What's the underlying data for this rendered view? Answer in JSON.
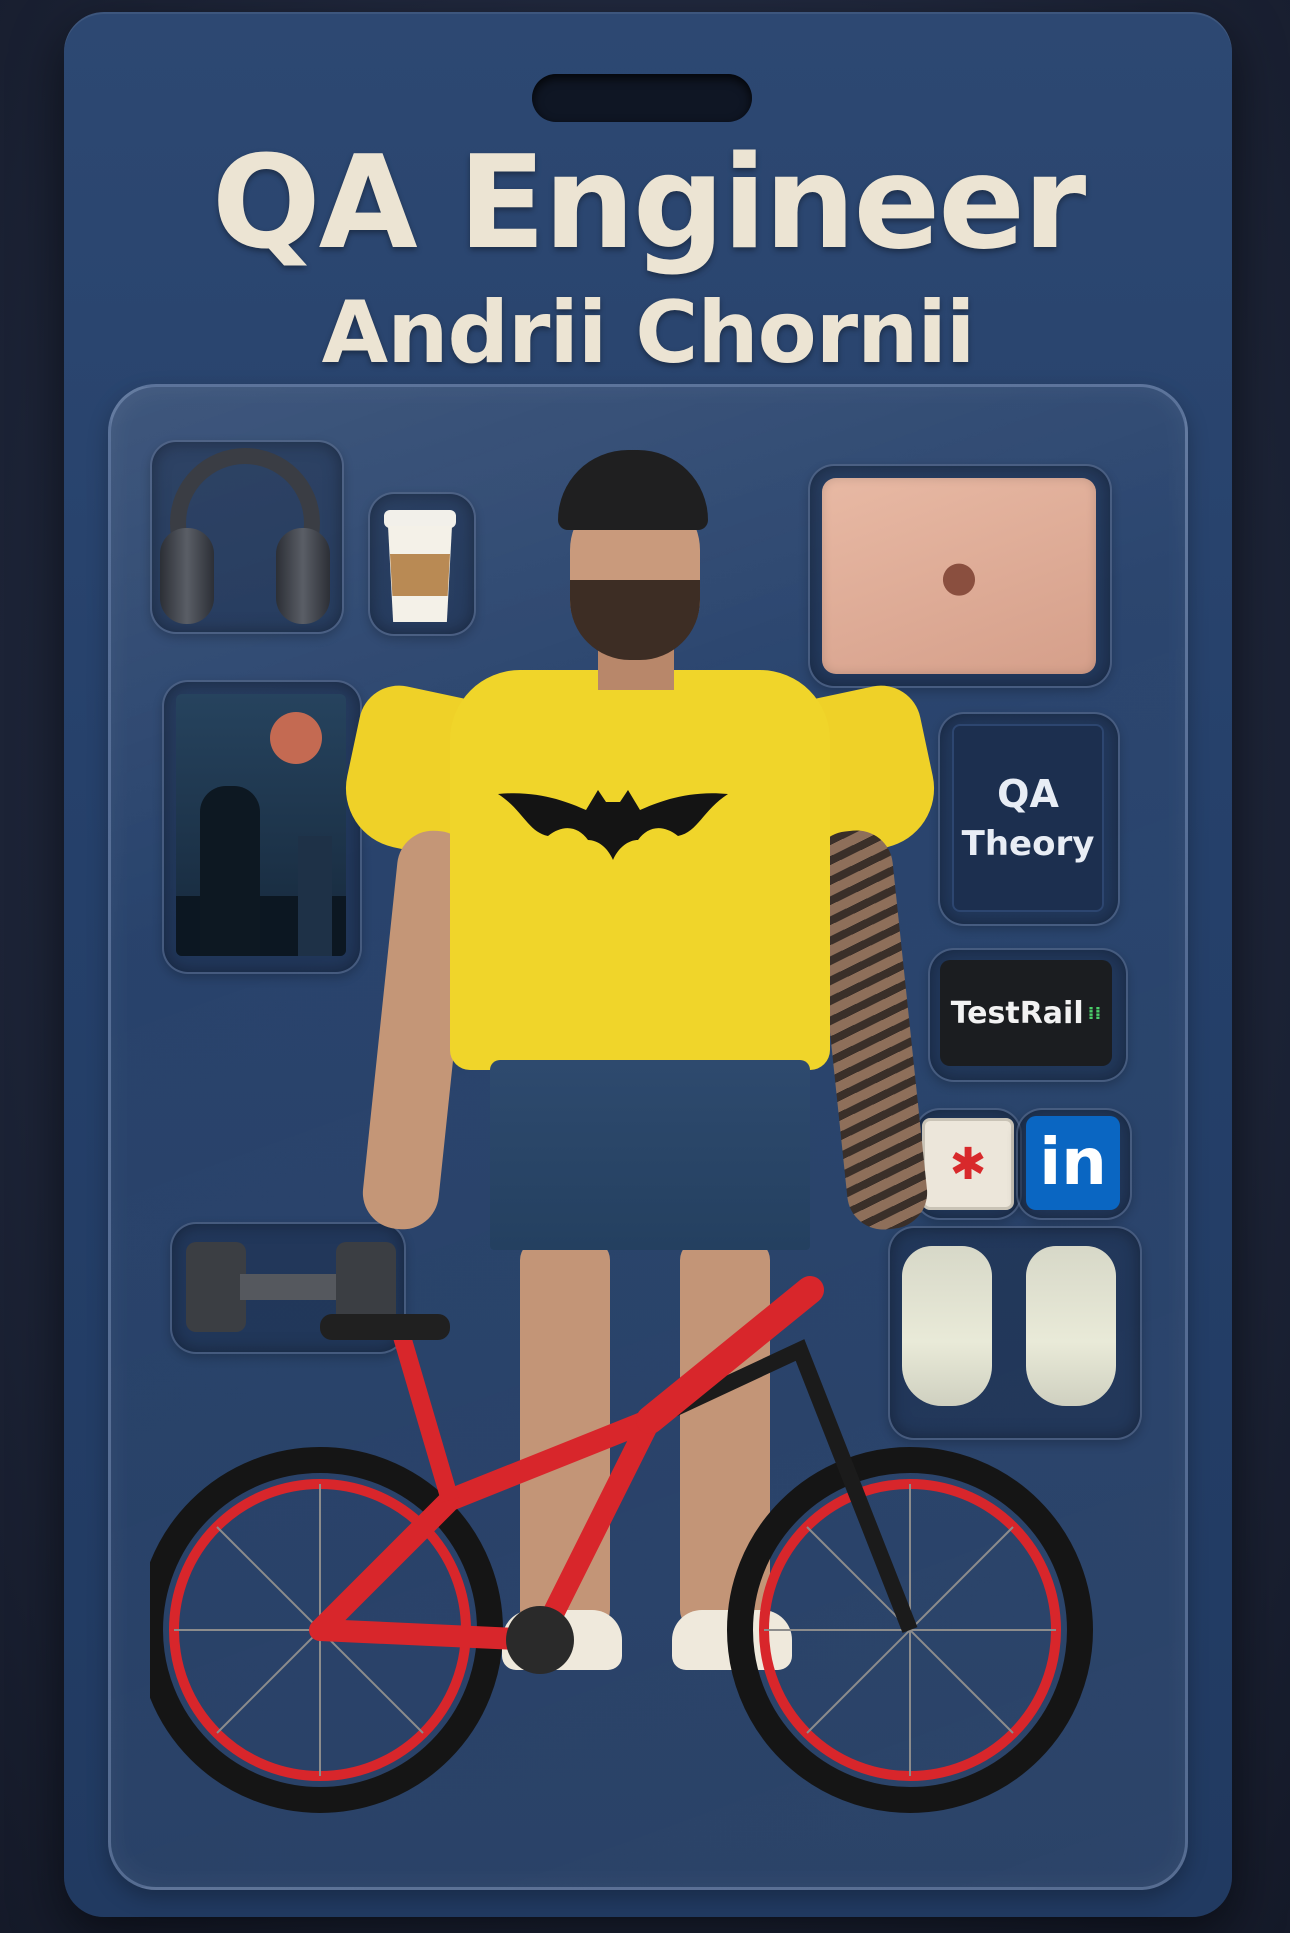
{
  "card": {
    "title": "QA Engineer",
    "name": "Andrii Chornii"
  },
  "accessories": {
    "book": {
      "line1": "QA",
      "line2": "Theory"
    },
    "testrail": {
      "label": "TestRail"
    },
    "linkedin": {
      "label": "in"
    }
  },
  "colors": {
    "card_blue": "#25406a",
    "title_cream": "#ece4d3",
    "shirt_yellow": "#f0d52a",
    "bike_red": "#d8262b",
    "linkedin_blue": "#0a66c2",
    "laptop_rose": "#e2b09b"
  },
  "icons": [
    "headphones-icon",
    "coffee-cup-icon",
    "laptop-icon",
    "apple-logo-icon",
    "batman-poster-icon",
    "bug-icon",
    "linkedin-icon",
    "dumbbell-icon",
    "boxing-gloves-icon",
    "bicycle-icon",
    "bat-logo-icon"
  ]
}
